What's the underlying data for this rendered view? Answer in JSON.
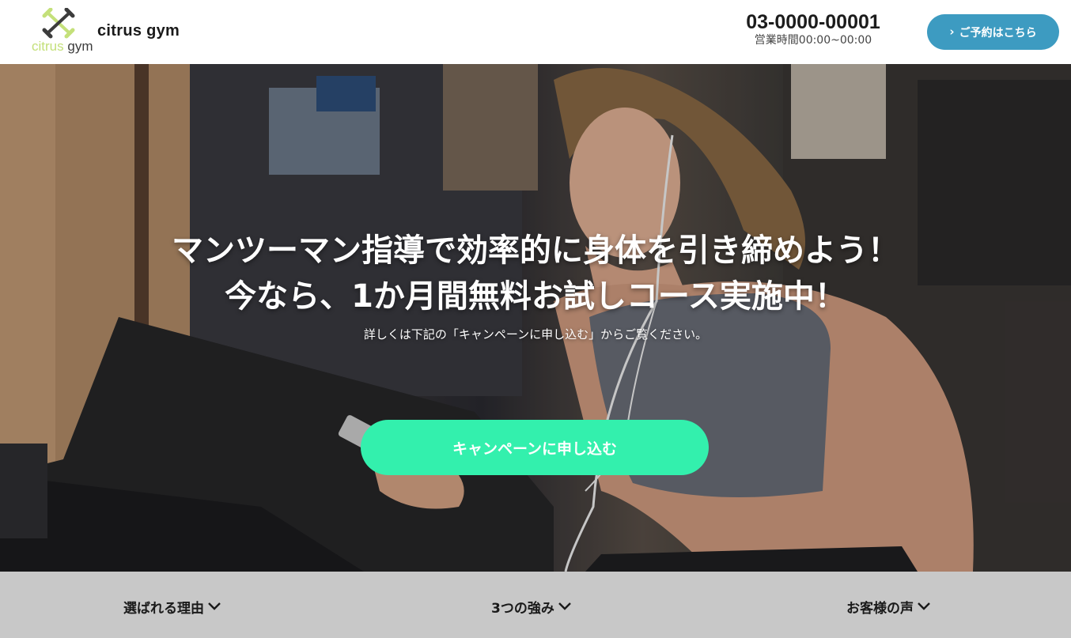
{
  "header": {
    "logo": {
      "word_citrus": "citrus",
      "word_gym": "gym",
      "icon": "dumbbell-icon"
    },
    "brand_name": "citrus gym",
    "phone": "03-0000-00001",
    "hours": "営業時間00:00~00:00",
    "reserve_button": {
      "icon": "chevron-right-icon",
      "label": "ご予約はこちら"
    }
  },
  "hero": {
    "headline_line1": "マンツーマン指導で効率的に身体を引き締めよう！",
    "headline_line2": "今なら、1か月間無料お試しコース実施中！",
    "subtext": "詳しくは下記の「キャンペーンに申し込む」からご覧ください。",
    "campaign_button": "キャンペーンに申し込む"
  },
  "bottom_nav": {
    "items": [
      {
        "label": "選ばれる理由",
        "icon": "chevron-down-icon"
      },
      {
        "label": "3つの強み",
        "icon": "chevron-down-icon"
      },
      {
        "label": "お客様の声",
        "icon": "chevron-down-icon"
      }
    ]
  },
  "colors": {
    "accent_blue": "#3d9bc1",
    "accent_green": "#33f0ad",
    "logo_green": "#c4e07a",
    "nav_bg": "#c8c8c8"
  }
}
